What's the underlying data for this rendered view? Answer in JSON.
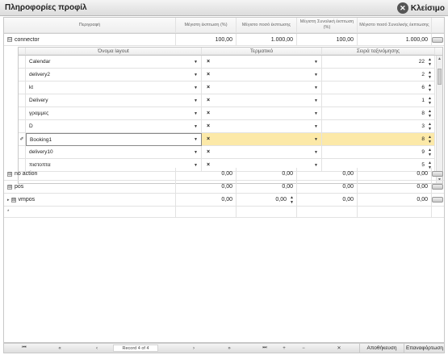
{
  "window": {
    "title": "Πληροφορίες προφίλ",
    "close_label": "Κλείσιμο"
  },
  "grid": {
    "columns": [
      "Περιγραφή",
      "Μέγιστη έκπτωση (%)",
      "Μέγιστο ποσό έκπτωσης",
      "Μέγιστη Συνολική έκπτωση (%)",
      "Μέγιστο ποσό Συνολικής έκπτωσης"
    ],
    "rows": [
      {
        "name": "connector",
        "expander": "⊟",
        "v1": "100,00",
        "v2": "1.000,00",
        "v3": "100,00",
        "v4": "1.000,00"
      },
      {
        "name": "no action",
        "expander": "⊞",
        "v1": "0,00",
        "v2": "0,00",
        "v3": "0,00",
        "v4": "0,00"
      },
      {
        "name": "pos",
        "expander": "⊞",
        "v1": "0,00",
        "v2": "0,00",
        "v3": "0,00",
        "v4": "0,00"
      },
      {
        "name": "vmpos",
        "expander": "⊞",
        "v1": "0,00",
        "v2": "0,00",
        "v3": "0,00",
        "v4": "0,00"
      }
    ],
    "new_row_marker": "*"
  },
  "detail": {
    "columns": [
      "Όνομα layout",
      "Τερματικό",
      "Σειρά ταξινόμησης"
    ],
    "rows": [
      {
        "layout": "Calendar",
        "terminal": "×",
        "order": "22"
      },
      {
        "layout": "delivery2",
        "terminal": "×",
        "order": "2"
      },
      {
        "layout": "kt",
        "terminal": "×",
        "order": "6"
      },
      {
        "layout": "Delivery",
        "terminal": "×",
        "order": "1"
      },
      {
        "layout": "γραμμες",
        "terminal": "×",
        "order": "8"
      },
      {
        "layout": "D",
        "terminal": "×",
        "order": "3"
      },
      {
        "layout": "Booking1",
        "terminal": "×",
        "order": "8"
      },
      {
        "layout": "delivery10",
        "terminal": "×",
        "order": "9"
      },
      {
        "layout": "πιστοπτα",
        "terminal": "×",
        "order": "5"
      }
    ],
    "edit_marker": "✐",
    "row_marker": "▸"
  },
  "footer": {
    "nav": [
      "⏮",
      "«",
      "‹",
      "›",
      "»",
      "⏭",
      "+",
      "−",
      "✕"
    ],
    "record_text": "Record 4 of 4",
    "save_label": "Αποθήκευση",
    "restore_label": "Επαναφόρτωση"
  }
}
